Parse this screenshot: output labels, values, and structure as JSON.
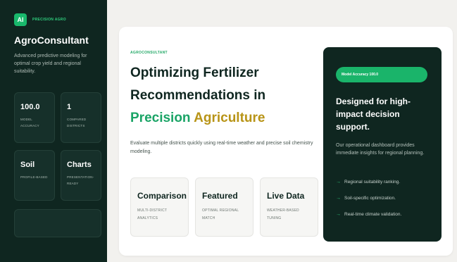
{
  "sidebar": {
    "logo_text": "AI",
    "brand_tag": "PRECISION AGRO",
    "app_title": "AgroConsultant",
    "description": "Advanced predictive modeling for optimal crop yield and regional suitability.",
    "stats": [
      {
        "value": "100.0",
        "label": "MODEL ACCURACY"
      },
      {
        "value": "1",
        "label": "COMPARED DISTRICTS"
      },
      {
        "value": "Soil",
        "label": "PROFILE-BASED"
      },
      {
        "value": "Charts",
        "label": "PRESENTATION-READY"
      }
    ]
  },
  "main": {
    "kicker": "AGROCONSULTANT",
    "headline": {
      "part1": "Optimizing Fertilizer Recommendations in ",
      "highlight_green": "Precision",
      "highlight_gold": "Agriculture"
    },
    "intro": "Evaluate multiple districts quickly using real-time weather and precise soil chemistry modeling.",
    "features": [
      {
        "title": "Comparison",
        "subtitle": "MULTI-DISTRICT ANALYTICS"
      },
      {
        "title": "Featured",
        "subtitle": "OPTIMAL REGIONAL MATCH"
      },
      {
        "title": "Live Data",
        "subtitle": "WEATHER-BASED TUNING"
      }
    ]
  },
  "panel": {
    "pill": "Model Accuracy 100.0",
    "title": "Designed for high-impact decision support.",
    "description": "Our operational dashboard provides immediate insights for regional planning.",
    "arrow_icon": "→",
    "items": [
      "Regional suitability ranking.",
      "Soil-specific optimization.",
      "Real-time climate validation."
    ]
  },
  "colors": {
    "dark_green": "#0f2620",
    "accent_green": "#1ab46a",
    "gold": "#b89417",
    "background": "#f2f1ee"
  }
}
